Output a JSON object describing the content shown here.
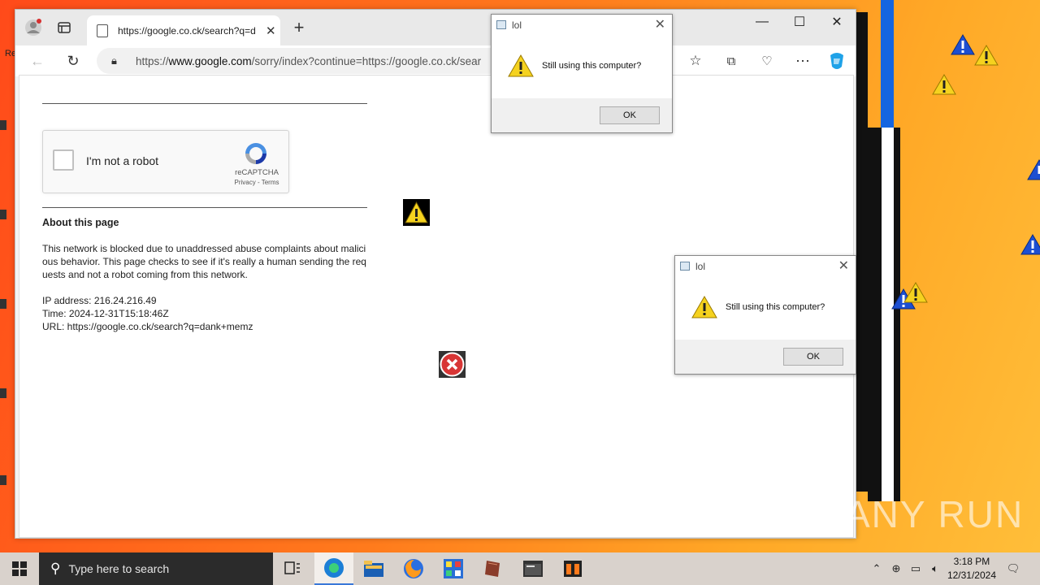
{
  "browser": {
    "tab_title": "https://google.co.ck/search?q=d",
    "url_prefix": "https://",
    "url_host": "www.google.com",
    "url_rest": "/sorry/index?continue=https://google.co.ck/sear"
  },
  "page": {
    "recaptcha": {
      "label": "I'm not a robot",
      "brand": "reCAPTCHA",
      "links": "Privacy - Terms"
    },
    "about_heading": "About this page",
    "about_text": "This network is blocked due to unaddressed abuse complaints about malicious behavior. This page checks to see if it's really a human sending the requests and not a robot coming from this network.",
    "ip": "IP address: 216.24.216.49",
    "time": "Time: 2024-12-31T15:18:46Z",
    "url": "URL: https://google.co.ck/search?q=dank+memz"
  },
  "dialogs": [
    {
      "title": "lol",
      "message": "Still using this computer?",
      "ok": "OK"
    },
    {
      "title": "lol",
      "message": "Still using this computer?",
      "ok": "OK"
    }
  ],
  "taskbar": {
    "search_placeholder": "Type here to search",
    "time": "3:18 PM",
    "date": "12/31/2024"
  },
  "watermark": "ANY RUN",
  "colors": {
    "accent": "#3a78d8",
    "taskbar": "#d9d2cc"
  }
}
